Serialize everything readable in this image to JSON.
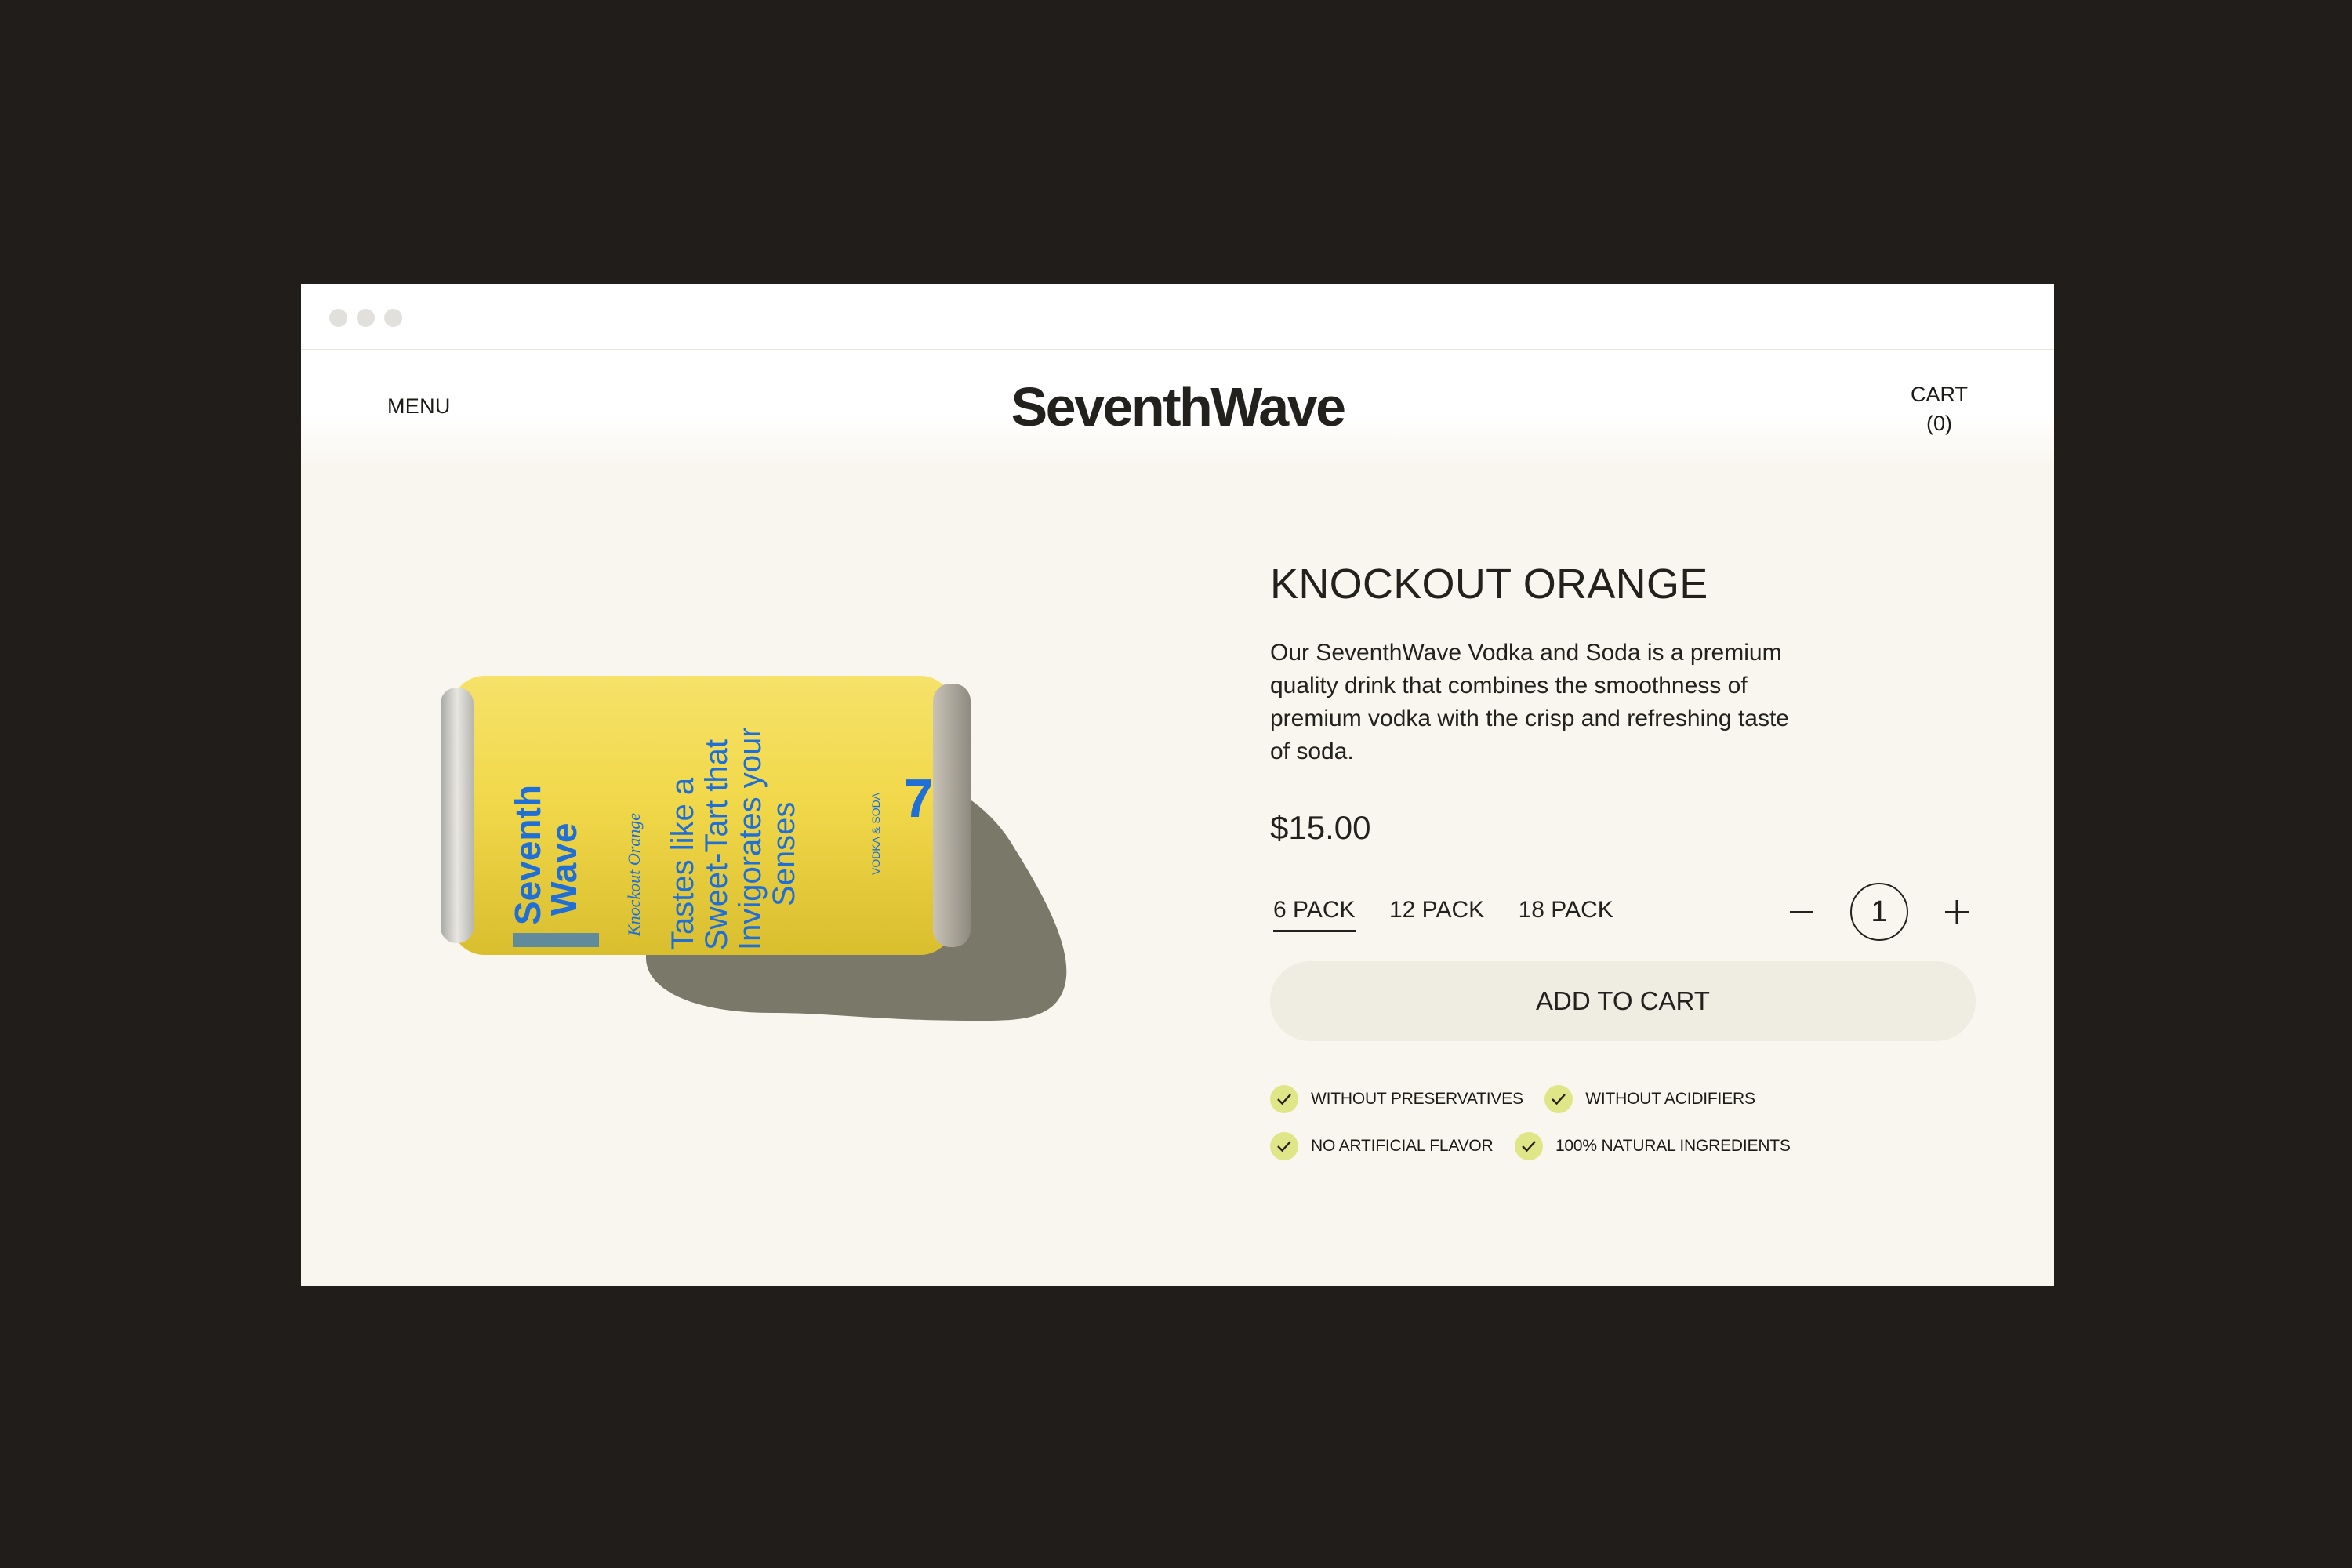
{
  "brand": {
    "name": "SeventhWave"
  },
  "nav": {
    "menu_label": "MENU",
    "cart_label": "CART",
    "cart_count": "(0)"
  },
  "product": {
    "title": "KNOCKOUT ORANGE",
    "description": "Our SeventhWave Vodka and Soda is a premium quality drink that combines the smoothness of premium vodka with the crisp and refreshing taste of soda.",
    "price": "$15.00",
    "packs": [
      "6 PACK",
      "12 PACK",
      "18 PACK"
    ],
    "selected_pack": "6 PACK",
    "quantity": "1",
    "add_to_cart_label": "ADD TO CART",
    "features": [
      "WITHOUT PRESERVATIVES",
      "WITHOUT ACIDIFIERS",
      "NO ARTIFICIAL FLAVOR",
      "100% NATURAL INGREDIENTS"
    ]
  },
  "can": {
    "brand_line1": "Seventh",
    "brand_line2": "Wave",
    "flavor": "Knockout Orange",
    "tagline_line1": "Tastes like a",
    "tagline_line2": "Sweet-Tart that",
    "tagline_line3": "Invigorates your",
    "tagline_line4": "Senses",
    "type": "VODKA & SODA",
    "logo_mark": "7"
  },
  "colors": {
    "page_background": "#201d1a",
    "window_background": "#f9f6ef",
    "text": "#23211d",
    "button_background": "#efece2",
    "check_badge": "#dfe687",
    "can_yellow": "#f1d84a",
    "can_blue": "#1f6fd6"
  },
  "icons": {
    "minus": "minus-icon",
    "plus": "plus-icon",
    "check": "check-icon"
  }
}
